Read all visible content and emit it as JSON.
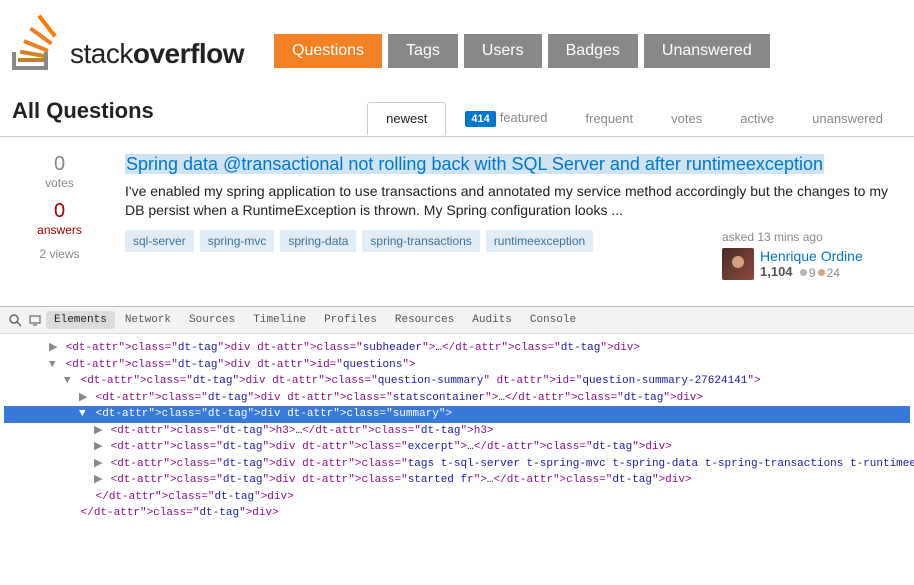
{
  "logo": {
    "part1": "stack",
    "part2": "overflow"
  },
  "nav": {
    "items": [
      {
        "label": "Questions",
        "active": true
      },
      {
        "label": "Tags"
      },
      {
        "label": "Users"
      },
      {
        "label": "Badges"
      },
      {
        "label": "Unanswered"
      }
    ]
  },
  "subheader": {
    "title": "All Questions"
  },
  "tabs": {
    "items": [
      {
        "label": "newest",
        "selected": true
      },
      {
        "badge": "414",
        "label": "featured"
      },
      {
        "label": "frequent"
      },
      {
        "label": "votes"
      },
      {
        "label": "active"
      },
      {
        "label": "unanswered"
      }
    ]
  },
  "question": {
    "votes": "0",
    "votes_label": "votes",
    "answers": "0",
    "answers_label": "answers",
    "views": "2 views",
    "title": "Spring data @transactional not rolling back with SQL Server and after runtimeexception",
    "excerpt": "I've enabled my spring application to use transactions and annotated my service method accordingly but the changes to my DB persist when a RuntimeException is thrown. My Spring configuration looks ...",
    "tags": [
      "sql-server",
      "spring-mvc",
      "spring-data",
      "spring-transactions",
      "runtimeexception"
    ],
    "asked_label": "asked",
    "asked_time": "13 mins ago",
    "user": "Henrique Ordine",
    "rep": "1,104",
    "silver": "9",
    "bronze": "24"
  },
  "devtools": {
    "tabs": [
      "Elements",
      "Network",
      "Sources",
      "Timeline",
      "Profiles",
      "Resources",
      "Audits",
      "Console"
    ],
    "lines": [
      {
        "indent": 2,
        "arrow": "▶",
        "html": "<div class=\"subheader\">…</div>"
      },
      {
        "indent": 2,
        "arrow": "▼",
        "html": "<div id=\"questions\">"
      },
      {
        "indent": 3,
        "arrow": "▼",
        "html": "<div class=\"question-summary\" id=\"question-summary-27624141\">"
      },
      {
        "indent": 4,
        "arrow": "▶",
        "html": "<div class=\"statscontainer\">…</div>"
      },
      {
        "indent": 4,
        "arrow": "▼",
        "html": "<div class=\"summary\">",
        "highlight": true
      },
      {
        "indent": 5,
        "arrow": "▶",
        "html": "<h3>…</h3>"
      },
      {
        "indent": 5,
        "arrow": "▶",
        "html": "<div class=\"excerpt\">…</div>"
      },
      {
        "indent": 5,
        "arrow": "▶",
        "html": "<div class=\"tags t-sql-server t-spring-mvc t-spring-data t-spring-transactions t-runtimeexception\">…</div>"
      },
      {
        "indent": 5,
        "arrow": "▶",
        "html": "<div class=\"started fr\">…</div>"
      },
      {
        "indent": 4,
        "arrow": "",
        "html": "</div>"
      },
      {
        "indent": 3,
        "arrow": "",
        "html": "</div>"
      }
    ]
  }
}
